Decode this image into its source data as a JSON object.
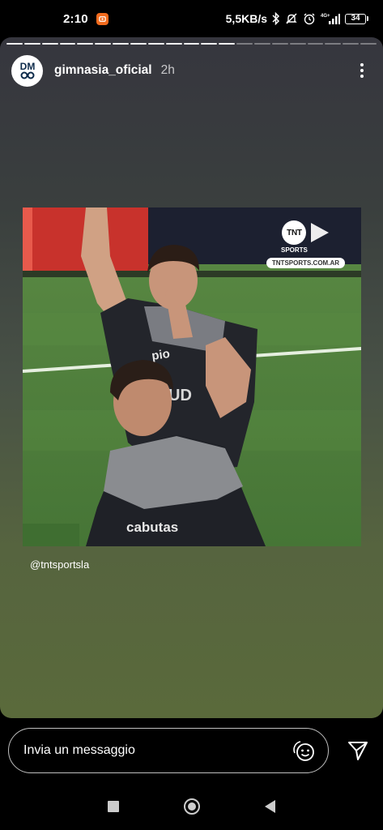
{
  "status_bar": {
    "time": "2:10",
    "network_speed": "5,5KB/s",
    "network_type": "4G+",
    "battery": "34",
    "icons": [
      "app-notification-icon",
      "bluetooth-icon",
      "mute-icon",
      "alarm-icon",
      "signal-icon",
      "battery-icon"
    ]
  },
  "story": {
    "username": "gimnasia_oficial",
    "time_ago": "2h",
    "avatar_text": "DM",
    "progress": {
      "total_segments": 21,
      "current_segment": 13
    },
    "media": {
      "broadcaster_logo": "TNT",
      "broadcaster_sub": "SPORTS",
      "broadcaster_url": "TNTSPORTS.COM.AR"
    },
    "mention": "@tntsportsla"
  },
  "reply": {
    "placeholder": "Invia un messaggio"
  },
  "colors": {
    "story_top": "#36363e",
    "story_bottom": "#5a6a3b",
    "app_badge": "#f26b1d",
    "pitch_green": "#4a7a38",
    "ad_board_red": "#c8322c"
  },
  "nav_bar": {
    "icons": [
      "recent-apps-icon",
      "home-icon",
      "back-icon"
    ]
  }
}
